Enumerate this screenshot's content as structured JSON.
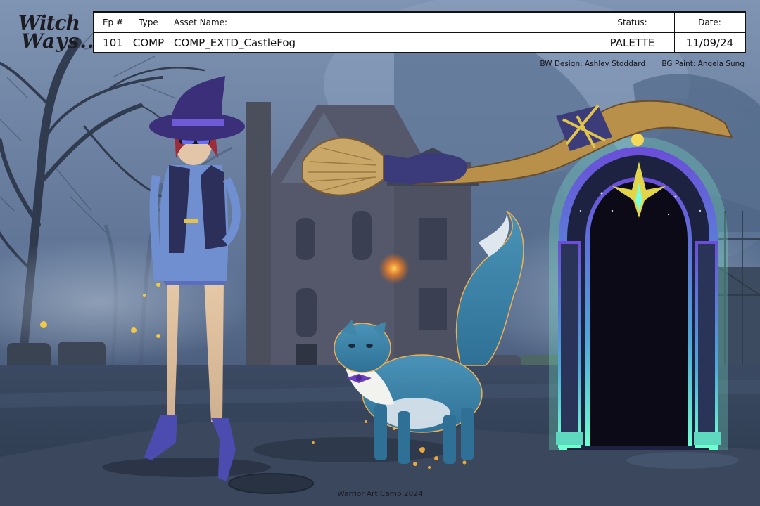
{
  "logo": {
    "line1": "Witch",
    "line2": "Ways.."
  },
  "slate": {
    "headers": {
      "ep": "Ep #",
      "type": "Type",
      "asset_name": "Asset Name:",
      "status": "Status:",
      "date": "Date:"
    },
    "values": {
      "ep": "101",
      "type": "COMP",
      "asset_name": "COMP_EXTD_CastleFog",
      "status": "PALETTE",
      "date": "11/09/24"
    }
  },
  "credits": {
    "bw_design": "BW Design: Ashley Stoddard",
    "bg_paint": "BG Paint: Angela Sung"
  },
  "footer": "Warrior Art Camp 2024",
  "colors": {
    "sky": "#6f86a6",
    "fog": "#a7b7c8",
    "portal_glow": "#7fffd8",
    "portal_frame": "#6a5ad8",
    "cat": "#3f86a8",
    "witch_hat": "#3a2f78"
  }
}
